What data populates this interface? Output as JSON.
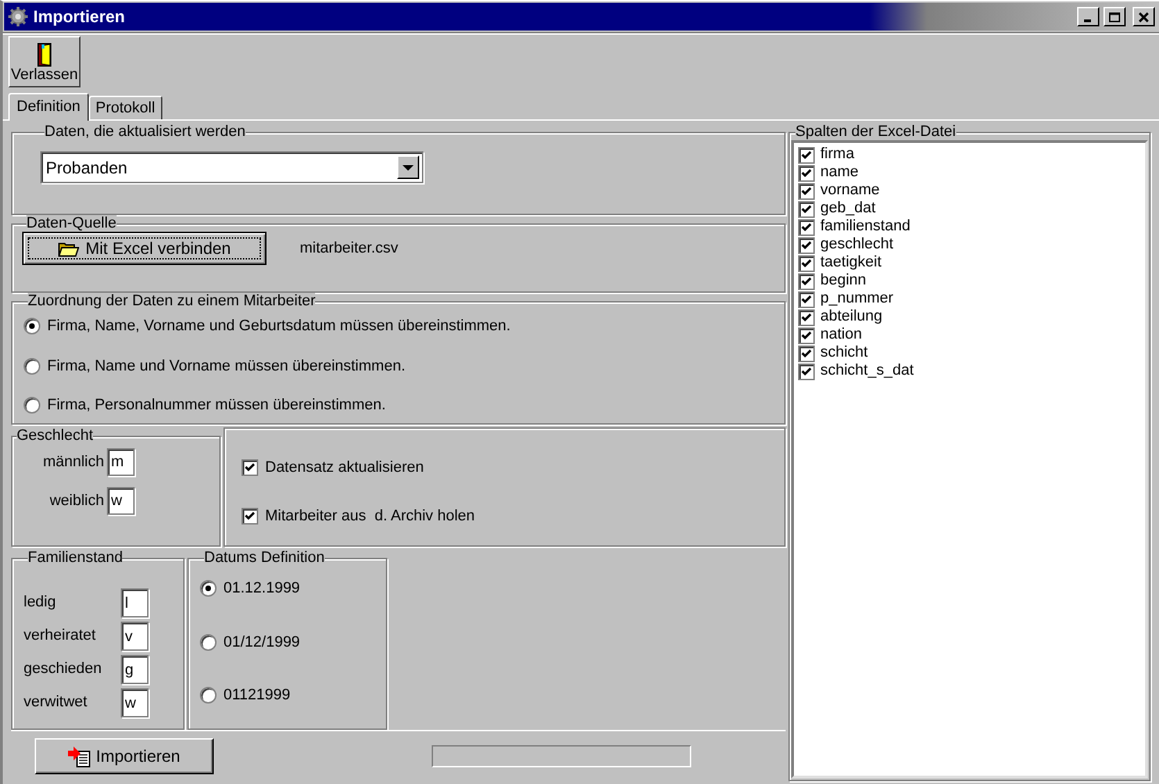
{
  "window": {
    "title": "Importieren"
  },
  "toolbar": [
    {
      "label": "Verlassen"
    }
  ],
  "tabs": [
    {
      "label": "Definition",
      "selected": true
    },
    {
      "label": "Protokoll",
      "selected": false
    }
  ],
  "data_group": {
    "title": "Daten, die aktualisiert werden",
    "dropdown": {
      "value": "Probanden"
    }
  },
  "source_group": {
    "title": "Daten-Quelle",
    "button": "Mit Excel verbinden",
    "file": "mitarbeiter.csv"
  },
  "matching_group": {
    "title": "Zuordnung der Daten zu einem Mitarbeiter",
    "options": [
      {
        "label": "Firma, Name, Vorname und Geburtsdatum müssen übereinstimmen.",
        "selected": true
      },
      {
        "label": "Firma, Name und Vorname müssen übereinstimmen.",
        "selected": false
      },
      {
        "label": "Firma, Personalnummer müssen übereinstimmen.",
        "selected": false
      }
    ]
  },
  "gender_group": {
    "title": "Geschlecht",
    "fields": [
      {
        "label": "männlich",
        "value": "m"
      },
      {
        "label": "weiblich",
        "value": "w"
      }
    ]
  },
  "options": [
    {
      "label": "Datensatz aktualisieren",
      "checked": true
    },
    {
      "label": "Mitarbeiter aus  d. Archiv holen",
      "checked": true
    }
  ],
  "marital_group": {
    "title": "Familienstand",
    "fields": [
      {
        "label": "ledig",
        "value": "l"
      },
      {
        "label": "verheiratet",
        "value": "v"
      },
      {
        "label": "geschieden",
        "value": "g"
      },
      {
        "label": "verwitwet",
        "value": "w"
      }
    ]
  },
  "date_group": {
    "title": "Datums Definition",
    "options": [
      {
        "label": "01.12.1999",
        "selected": true
      },
      {
        "label": "01/12/1999",
        "selected": false
      },
      {
        "label": "01121999",
        "selected": false
      }
    ]
  },
  "import_button": "Importieren",
  "progress": {
    "level": 0
  },
  "columns_group": {
    "title": "Spalten der Excel-Datei",
    "items": [
      {
        "label": "firma",
        "checked": true
      },
      {
        "label": "name",
        "checked": true
      },
      {
        "label": "vorname",
        "checked": true
      },
      {
        "label": "geb_dat",
        "checked": true
      },
      {
        "label": "familienstand",
        "checked": true
      },
      {
        "label": "geschlecht",
        "checked": true
      },
      {
        "label": "taetigkeit",
        "checked": true
      },
      {
        "label": "beginn",
        "checked": true
      },
      {
        "label": "p_nummer",
        "checked": true
      },
      {
        "label": "abteilung",
        "checked": true
      },
      {
        "label": "nation",
        "checked": true
      },
      {
        "label": "schicht",
        "checked": true
      },
      {
        "label": "schicht_s_dat",
        "checked": true
      }
    ]
  }
}
